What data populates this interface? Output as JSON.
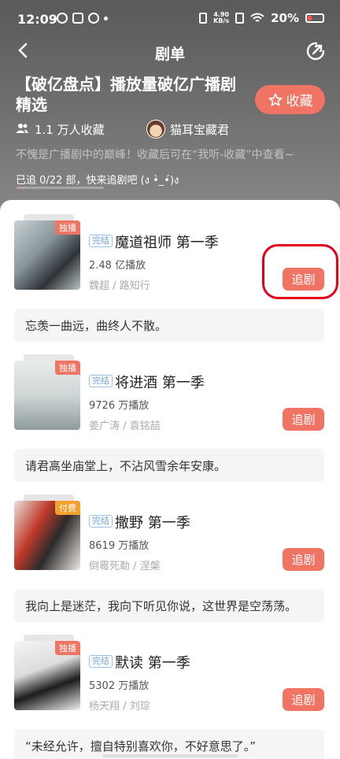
{
  "status": {
    "time": "12:09",
    "speed_top": "4.90",
    "speed_bottom": "KB/s",
    "battery": "20%"
  },
  "nav": {
    "title": "剧单"
  },
  "playlist": {
    "title": "【破亿盘点】播放量破亿广播剧精选",
    "fav_button": "收藏",
    "fav_count": "1.1 万人收藏",
    "author": "猫耳宝藏君",
    "description": "不愧是广播剧中的巅峰！收藏后可在“我听-收藏”中查看~",
    "progress_text": "已追 0/22 部，快来追剧吧 (ง •̀_•́)ง",
    "progress_fraction": 0.0
  },
  "items": [
    {
      "tag": "独播",
      "badge": "完结",
      "title": "魔道祖师 第一季",
      "plays": "2.48 亿播放",
      "cast": "魏超 / 路知行",
      "button": "追剧",
      "quote": "忘羡一曲远，曲终人不散。",
      "cover_colors": [
        "#b9c3c6",
        "#3b3f45"
      ]
    },
    {
      "tag": "独播",
      "badge": "完结",
      "title": "将进酒 第一季",
      "plays": "9726 万播放",
      "cast": "姜广涛 / 袁铭喆",
      "button": "追剧",
      "quote": "请君高坐庙堂上，不沾风雪余年安康。",
      "cover_colors": [
        "#dfe3e2",
        "#7d8c8e"
      ]
    },
    {
      "tag": "付费",
      "badge": "完结",
      "title": "撒野 第一季",
      "plays": "8619 万播放",
      "cast": "倒霉死勒 / 涅槃",
      "button": "追剧",
      "quote": "我向上是迷茫，我向下听见你说，这世界是空荡荡。",
      "cover_colors": [
        "#c0392b",
        "#2b2b2b"
      ]
    },
    {
      "tag": "独播",
      "badge": "完结",
      "title": "默读 第一季",
      "plays": "5302 万播放",
      "cast": "杨天翔 / 刘琮",
      "button": "追剧",
      "quote": "“未经允许，擅自特别喜欢你，不好意思了。”",
      "cover_colors": [
        "#f2f2f2",
        "#1a1a1a"
      ]
    }
  ]
}
